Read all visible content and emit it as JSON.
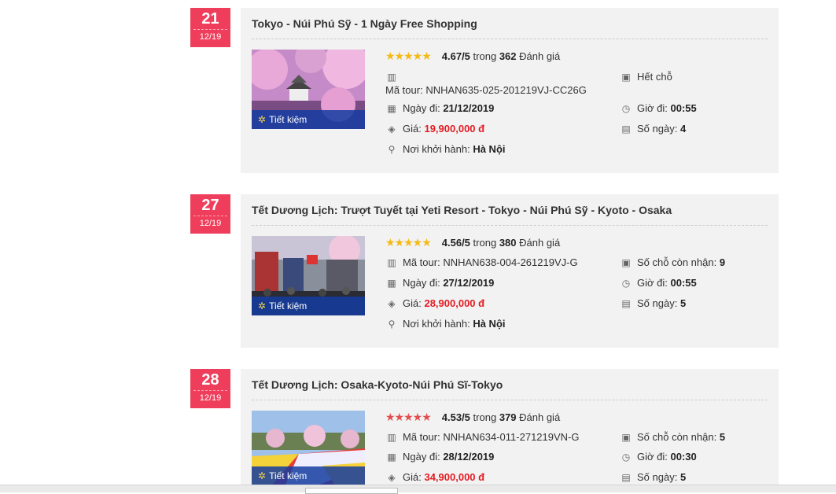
{
  "tours": [
    {
      "day": "21",
      "month": "12/19",
      "title": "Tokyo - Núi Phú Sỹ - 1 Ngày Free Shopping",
      "rating": "4.67/5",
      "rating_sep": "trong",
      "reviews": "362",
      "reviews_label": "Đánh giá",
      "code_label": "Mã tour:",
      "code": "NNHAN635-025-201219VJ-CC26G",
      "date_label": "Ngày đi:",
      "date": "21/12/2019",
      "price_label": "Giá:",
      "price": "19,900,000 đ",
      "origin_label": "Nơi khởi hành:",
      "origin": "Hà Nội",
      "seats_text": "Hết chỗ",
      "time_label": "Giờ đi:",
      "time": "00:55",
      "days_label": "Số ngày:",
      "days": "4",
      "badge": "Tiết kiệm"
    },
    {
      "day": "27",
      "month": "12/19",
      "title": "Tết Dương Lịch: Trượt Tuyết tại Yeti Resort - Tokyo - Núi Phú Sỹ - Kyoto - Osaka",
      "rating": "4.56/5",
      "rating_sep": "trong",
      "reviews": "380",
      "reviews_label": "Đánh giá",
      "code_label": "Mã tour:",
      "code": "NNHAN638-004-261219VJ-G",
      "date_label": "Ngày đi:",
      "date": "27/12/2019",
      "price_label": "Giá:",
      "price": "28,900,000 đ",
      "origin_label": "Nơi khởi hành:",
      "origin": "Hà Nội",
      "seats_label": "Số chỗ còn nhận:",
      "seats": "9",
      "time_label": "Giờ đi:",
      "time": "00:55",
      "days_label": "Số ngày:",
      "days": "5",
      "badge": "Tiết kiệm"
    },
    {
      "day": "28",
      "month": "12/19",
      "title": "Tết Dương Lịch: Osaka-Kyoto-Núi Phú Sĩ-Tokyo",
      "rating": "4.53/5",
      "rating_sep": "trong",
      "reviews": "379",
      "reviews_label": "Đánh giá",
      "code_label": "Mã tour:",
      "code": "NNHAN634-011-271219VN-G",
      "date_label": "Ngày đi:",
      "date": "28/12/2019",
      "price_label": "Giá:",
      "price": "34,900,000 đ",
      "seats_label": "Số chỗ còn nhận:",
      "seats": "5",
      "time_label": "Giờ đi:",
      "time": "00:30",
      "days_label": "Số ngày:",
      "days": "5",
      "badge": "Tiết kiệm"
    }
  ],
  "icons": {
    "stars": "★★★★★",
    "barcode": "barcode-icon",
    "calendar": "calendar-icon",
    "price": "price-tag-icon",
    "origin": "location-pin-icon",
    "seats": "bus-icon",
    "time": "clock-icon",
    "days": "days-calendar-icon",
    "save": "savings-icon"
  },
  "colors": {
    "badge": "#ef3e5b",
    "price": "#e31b23",
    "stars": "#f5b914",
    "save_bar": "#143ca0"
  }
}
